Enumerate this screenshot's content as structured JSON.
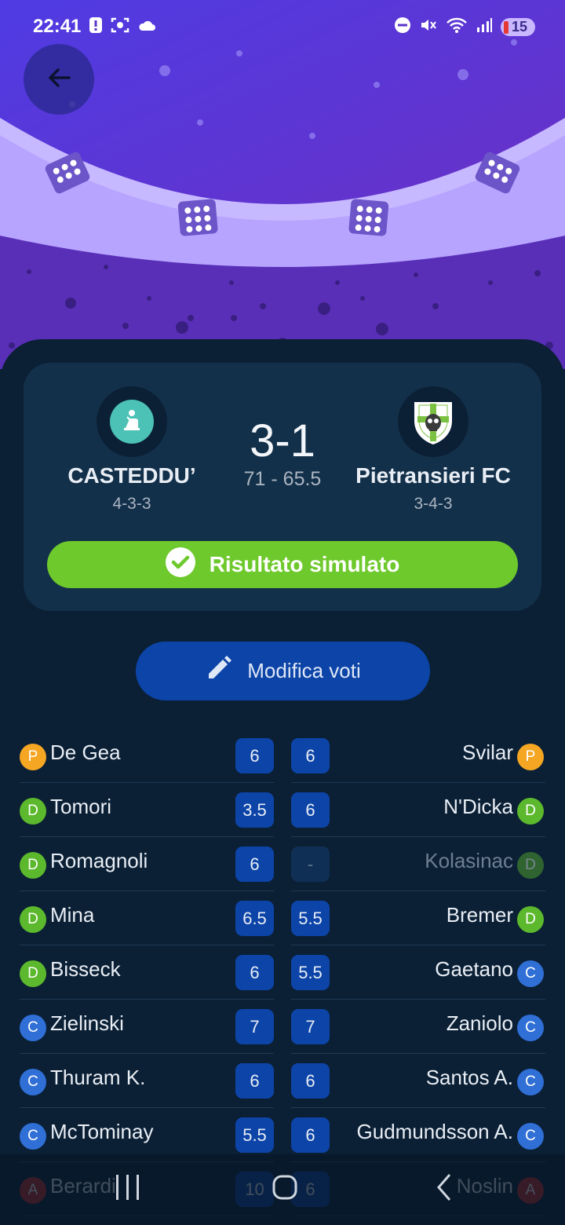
{
  "status_bar": {
    "time": "22:41",
    "battery": "15",
    "icons": [
      "alert-icon",
      "screenshot-icon",
      "cloud-icon",
      "dnd-icon",
      "mute-icon",
      "wifi-icon",
      "signal-icon"
    ]
  },
  "match": {
    "home": {
      "name": "CASTEDDU’",
      "formation": "4-3-3"
    },
    "away": {
      "name": "Pietransieri FC",
      "formation": "3-4-3"
    },
    "score": "3-1",
    "points": "71 - 65.5",
    "status_label": "Risultato simulato"
  },
  "edit_button_label": "Modifica voti",
  "role_colors": {
    "P": "#f5a623",
    "D": "#5cb82c",
    "C": "#2f6fd6",
    "A": "#c62828"
  },
  "lineup": [
    {
      "home": {
        "role": "P",
        "name": "De Gea",
        "vote": "6"
      },
      "away": {
        "role": "P",
        "name": "Svilar",
        "vote": "6"
      }
    },
    {
      "home": {
        "role": "D",
        "name": "Tomori",
        "vote": "3.5"
      },
      "away": {
        "role": "D",
        "name": "N'Dicka",
        "vote": "6"
      }
    },
    {
      "home": {
        "role": "D",
        "name": "Romagnoli",
        "vote": "6"
      },
      "away": {
        "role": "D",
        "name": "Kolasinac",
        "vote": "-"
      }
    },
    {
      "home": {
        "role": "D",
        "name": "Mina",
        "vote": "6.5"
      },
      "away": {
        "role": "D",
        "name": "Bremer",
        "vote": "5.5"
      }
    },
    {
      "home": {
        "role": "D",
        "name": "Bisseck",
        "vote": "6"
      },
      "away": {
        "role": "C",
        "name": "Gaetano",
        "vote": "5.5"
      }
    },
    {
      "home": {
        "role": "C",
        "name": "Zielinski",
        "vote": "7"
      },
      "away": {
        "role": "C",
        "name": "Zaniolo",
        "vote": "7"
      }
    },
    {
      "home": {
        "role": "C",
        "name": "Thuram K.",
        "vote": "6"
      },
      "away": {
        "role": "C",
        "name": "Santos A.",
        "vote": "6"
      }
    },
    {
      "home": {
        "role": "C",
        "name": "McTominay",
        "vote": "5.5"
      },
      "away": {
        "role": "C",
        "name": "Gudmundsson A.",
        "vote": "6"
      }
    },
    {
      "home": {
        "role": "A",
        "name": "Berardi",
        "vote": "10"
      },
      "away": {
        "role": "A",
        "name": "Noslin",
        "vote": "6"
      }
    }
  ]
}
